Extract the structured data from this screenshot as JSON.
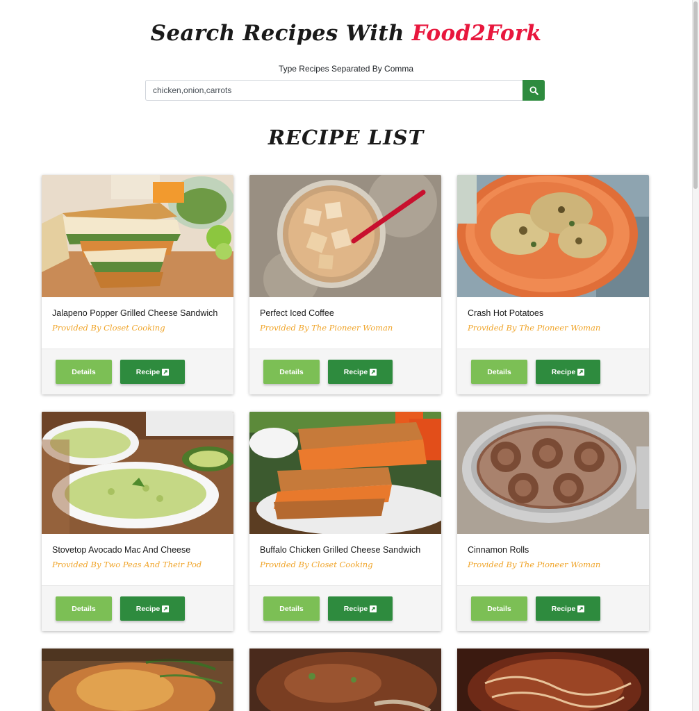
{
  "header": {
    "title_prefix": "Search Recipes With ",
    "title_brand": "Food2Fork",
    "search_label": "Type Recipes Separated By Comma",
    "search_value": "chicken,onion,carrots"
  },
  "list": {
    "title": "RECIPE LIST",
    "details_label": "Details",
    "recipe_label": "Recipe",
    "recipes": [
      {
        "title": "Jalapeno Popper Grilled Cheese Sandwich",
        "publisher": "Provided By Closet Cooking"
      },
      {
        "title": "Perfect Iced Coffee",
        "publisher": "Provided By The Pioneer Woman"
      },
      {
        "title": "Crash Hot Potatoes",
        "publisher": "Provided By The Pioneer Woman"
      },
      {
        "title": "Stovetop Avocado Mac And Cheese",
        "publisher": "Provided By Two Peas And Their Pod"
      },
      {
        "title": "Buffalo Chicken Grilled Cheese Sandwich",
        "publisher": "Provided By Closet Cooking"
      },
      {
        "title": "Cinnamon Rolls",
        "publisher": "Provided By The Pioneer Woman"
      }
    ]
  },
  "icons": {
    "search": "search-icon",
    "external_link": "external-link-icon"
  },
  "colors": {
    "brand": "#e8173d",
    "publisher": "#f0a52b",
    "details_button": "#7cbf55",
    "recipe_button": "#2e8b3e"
  }
}
